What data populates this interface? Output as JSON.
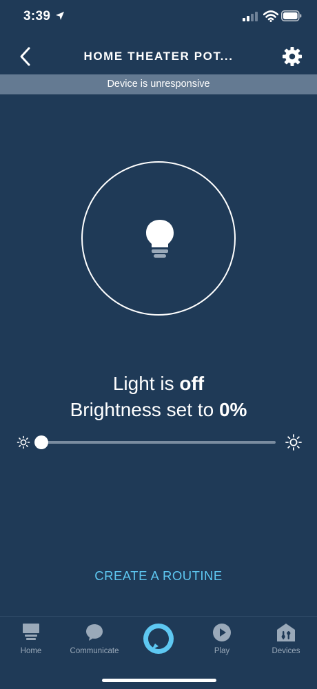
{
  "status_bar": {
    "time": "3:39"
  },
  "header": {
    "title": "HOME THEATER POT..."
  },
  "banner": {
    "text": "Device is unresponsive"
  },
  "device": {
    "light_prefix": "Light is ",
    "light_state": "off",
    "brightness_prefix": "Brightness set to ",
    "brightness_value": "0%",
    "brightness_percent": 0
  },
  "routine": {
    "label": "CREATE A ROUTINE"
  },
  "nav": {
    "items": [
      {
        "label": "Home",
        "icon": "home-icon"
      },
      {
        "label": "Communicate",
        "icon": "chat-icon"
      },
      {
        "label": "",
        "icon": "alexa-icon"
      },
      {
        "label": "Play",
        "icon": "play-icon"
      },
      {
        "label": "Devices",
        "icon": "devices-icon"
      }
    ]
  },
  "colors": {
    "background": "#1f3a57",
    "banner": "#647a92",
    "accent": "#5ec8f2",
    "nav_label": "#9aa9b9"
  }
}
